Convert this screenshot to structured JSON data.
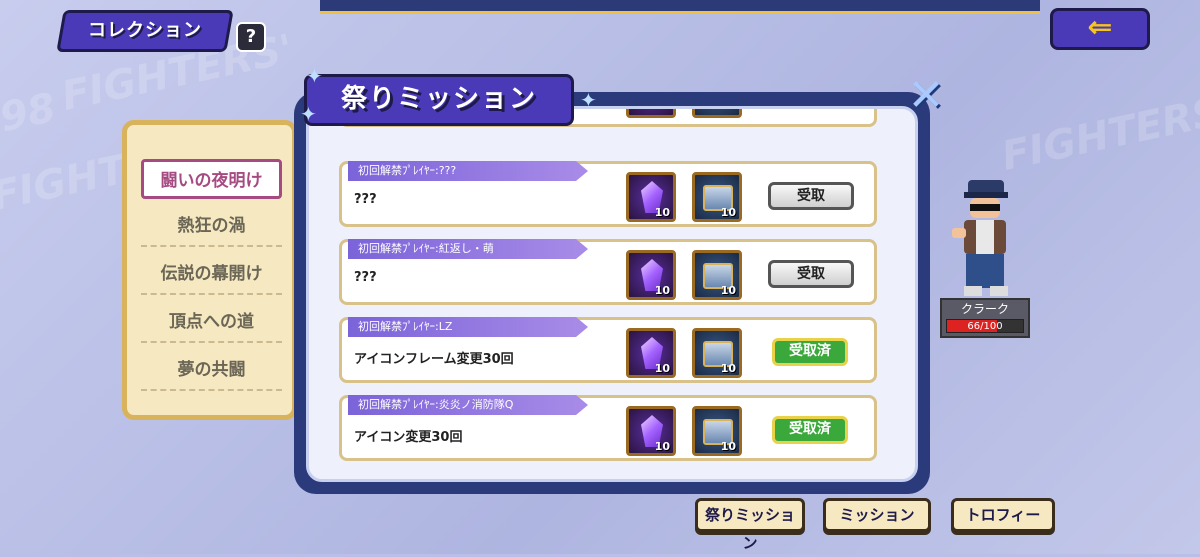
{
  "header": {
    "collection_label": "コレクション",
    "help_label": "?",
    "back_icon": "back-arrow-icon"
  },
  "background_texts": [
    "FIGHTERS'",
    "FIGHTERS'",
    "FIGHTERS'",
    "98"
  ],
  "left_menu": {
    "items": [
      {
        "label": "闘いの夜明け",
        "active": true
      },
      {
        "label": "熱狂の渦",
        "active": false
      },
      {
        "label": "伝説の幕開け",
        "active": false
      },
      {
        "label": "頂点への道",
        "active": false
      },
      {
        "label": "夢の共闘",
        "active": false
      }
    ]
  },
  "character": {
    "name": "クラーク",
    "hp_text": "66/100",
    "hp_fraction": 0.66
  },
  "dialog": {
    "title": "祭りミッション",
    "close_icon": "close-icon",
    "partial_row_desc": "???",
    "missions": [
      {
        "label": "初回解禁ﾌﾟﾚｲﾔｰ:???",
        "desc": "???",
        "rewards": [
          {
            "type": "gem",
            "qty": "10"
          },
          {
            "type": "box",
            "qty": "10"
          }
        ],
        "status": "receive",
        "button_label": "受取"
      },
      {
        "label": "初回解禁ﾌﾟﾚｲﾔｰ:紅返し・萌",
        "desc": "???",
        "rewards": [
          {
            "type": "gem",
            "qty": "10"
          },
          {
            "type": "box",
            "qty": "10"
          }
        ],
        "status": "receive",
        "button_label": "受取"
      },
      {
        "label": "初回解禁ﾌﾟﾚｲﾔｰ:LZ",
        "desc": "アイコンフレーム変更30回",
        "rewards": [
          {
            "type": "gem",
            "qty": "10"
          },
          {
            "type": "box",
            "qty": "10"
          }
        ],
        "status": "done",
        "button_label": "受取済"
      },
      {
        "label": "初回解禁ﾌﾟﾚｲﾔｰ:炎炎ノ消防隊Q",
        "desc": "アイコン変更30回",
        "rewards": [
          {
            "type": "gem",
            "qty": "10"
          },
          {
            "type": "box",
            "qty": "10"
          }
        ],
        "status": "done",
        "button_label": "受取済"
      }
    ]
  },
  "bottom_tabs": [
    {
      "label": "祭りミッション"
    },
    {
      "label": "ミッション"
    },
    {
      "label": "トロフィー"
    }
  ],
  "colors": {
    "accent_purple": "#4b3ab8",
    "panel_navy": "#2a3a7a",
    "done_green": "#3aa83a",
    "label_violet": "#7b63d9"
  }
}
